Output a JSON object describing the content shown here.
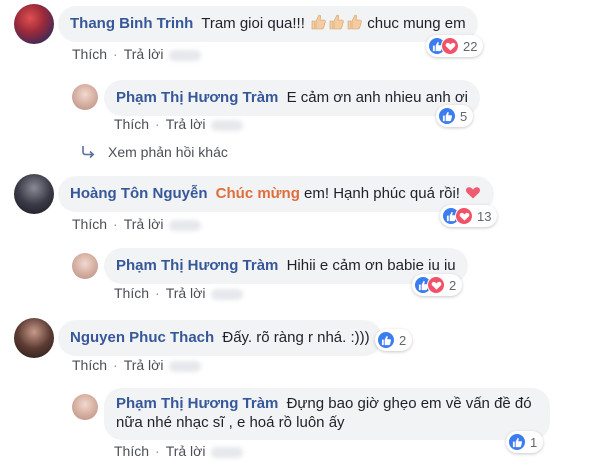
{
  "comments": [
    {
      "author": "Thang Binh Trinh",
      "text_before": "Tram gioi qua!!!",
      "text_after": "chuc mung em",
      "reaction_count": "22",
      "reactions": [
        "like-icon",
        "love-icon"
      ]
    },
    {
      "author": "Phạm Thị Hương Tràm",
      "text": "E cảm ơn anh nhieu anh ơi",
      "reaction_count": "5",
      "reactions": [
        "like-icon"
      ]
    },
    {
      "author": "Hoàng Tôn Nguyễn",
      "highlight": "Chúc mừng",
      "text": " em! Hạnh phúc quá rồi!",
      "reaction_count": "13",
      "reactions": [
        "like-icon",
        "love-icon"
      ]
    },
    {
      "author": "Phạm Thị Hương Tràm",
      "text": "Hihii e cảm ơn babie iu iu",
      "reaction_count": "2",
      "reactions": [
        "like-icon",
        "love-icon"
      ]
    },
    {
      "author": "Nguyen Phuc Thach",
      "text": "Đấy. rõ ràng r nhá. :)))",
      "reaction_count": "2",
      "reactions": [
        "like-icon"
      ]
    },
    {
      "author": "Phạm Thị Hương Tràm",
      "text": "Đựng bao giờ ghẹo em về vấn đề đó nữa nhé nhạc sĩ , e hoá rồ luôn ấy",
      "reaction_count": "1",
      "reactions": [
        "like-icon"
      ]
    }
  ],
  "actions": {
    "like": "Thích",
    "reply": "Trả lời",
    "separator": "·"
  },
  "view_more_replies": "Xem phản hồi khác",
  "colors": {
    "author": "#365899",
    "highlight": "#e06e3c",
    "like": "#3b7cf0",
    "love": "#f25268",
    "bubble": "#f2f3f5"
  }
}
